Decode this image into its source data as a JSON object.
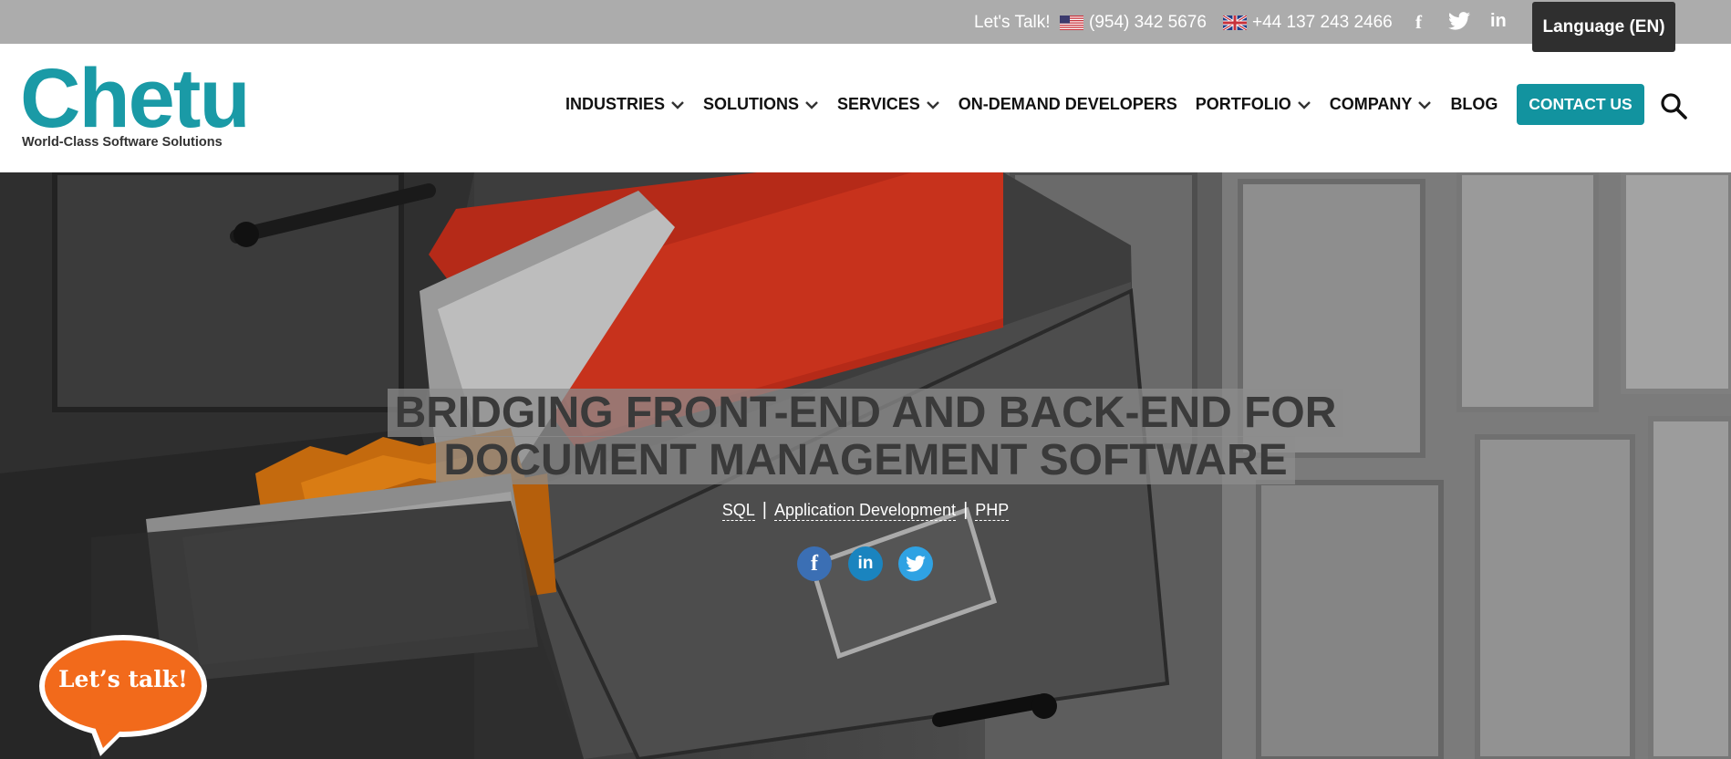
{
  "topbar": {
    "lets_talk": "Let's Talk!",
    "us_phone": "(954) 342 5676",
    "uk_phone": "+44 137 243 2466",
    "social_icons": [
      "facebook-icon",
      "twitter-icon",
      "linkedin-icon"
    ],
    "language_label": "Language (EN)"
  },
  "header": {
    "logo_brand": "Chetu",
    "logo_tagline": "World-Class Software Solutions",
    "nav": [
      {
        "label": "INDUSTRIES",
        "has_dropdown": true
      },
      {
        "label": "SOLUTIONS",
        "has_dropdown": true
      },
      {
        "label": "SERVICES",
        "has_dropdown": true
      },
      {
        "label": "ON-DEMAND DEVELOPERS",
        "has_dropdown": false
      },
      {
        "label": "PORTFOLIO",
        "has_dropdown": true
      },
      {
        "label": "COMPANY",
        "has_dropdown": true
      },
      {
        "label": "BLOG",
        "has_dropdown": false
      }
    ],
    "contact_label": "CONTACT US"
  },
  "hero": {
    "title_line1": "BRIDGING FRONT-END AND BACK-END FOR",
    "title_line2": "DOCUMENT MANAGEMENT SOFTWARE",
    "tags": [
      "SQL",
      "Application Development",
      "PHP"
    ],
    "tag_separator": "|",
    "share_icons": [
      "facebook-icon",
      "linkedin-icon",
      "twitter-icon"
    ]
  },
  "chat": {
    "bubble_label": "Let’s talk!"
  },
  "colors": {
    "brand_teal": "#1a9aa6",
    "contact_button": "#12939f",
    "topbar_gray": "#acacac",
    "language_button": "#2f2f2f",
    "chat_orange": "#f26a1b"
  }
}
